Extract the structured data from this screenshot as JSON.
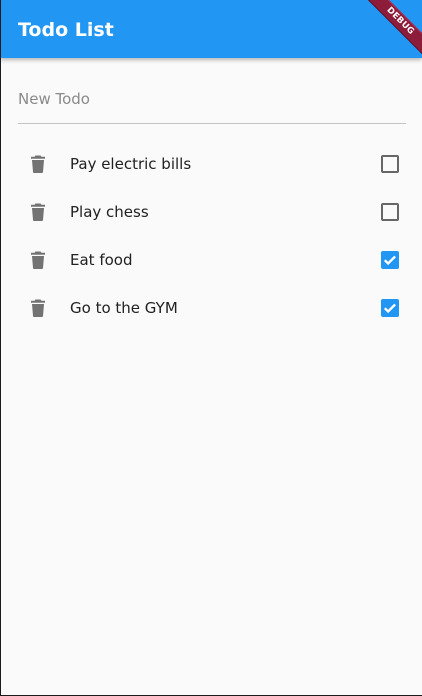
{
  "app_bar": {
    "title": "Todo List",
    "color": "#2196f3",
    "debug_banner": "DEBUG"
  },
  "new_todo": {
    "placeholder": "New Todo",
    "value": ""
  },
  "todos": [
    {
      "text": "Pay electric bills",
      "done": false,
      "icon": "trash-icon"
    },
    {
      "text": "Play chess",
      "done": false,
      "icon": "trash-icon"
    },
    {
      "text": "Eat food",
      "done": true,
      "icon": "trash-icon"
    },
    {
      "text": "Go to the GYM",
      "done": true,
      "icon": "trash-icon"
    }
  ]
}
